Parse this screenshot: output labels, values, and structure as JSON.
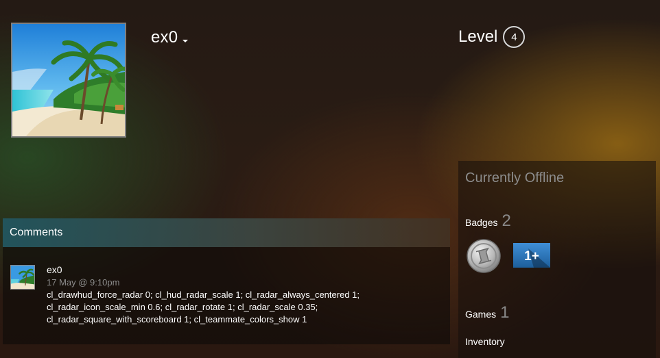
{
  "profile": {
    "persona_name": "ex0",
    "level_label": "Level",
    "level": "4",
    "avatar_icon": "beach-palm-avatar"
  },
  "right_panel": {
    "status": "Currently Offline",
    "badges_label": "Badges",
    "badges_count": "2",
    "badge_icons": [
      "silver-coin-badge-icon",
      "years-of-service-1-badge-icon"
    ],
    "badge_1_text": "1+",
    "games_label": "Games",
    "games_count": "1",
    "inventory_label": "Inventory"
  },
  "comments": {
    "title": "Comments",
    "items": [
      {
        "author": "ex0",
        "timestamp": "17 May @ 9:10pm",
        "lines": [
          "cl_drawhud_force_radar 0; cl_hud_radar_scale 1; cl_radar_always_centered 1;",
          "cl_radar_icon_scale_min 0.6; cl_radar_rotate 1; cl_radar_scale 0.35;",
          "cl_radar_square_with_scoreboard 1; cl_teammate_colors_show 1"
        ]
      }
    ]
  },
  "colors": {
    "muted_text": "#8c8c8c",
    "comments_header_accent": "#235a64",
    "badge_blue": "#2a6fb4",
    "glow_gold": "#966914",
    "glow_green": "#285528"
  }
}
